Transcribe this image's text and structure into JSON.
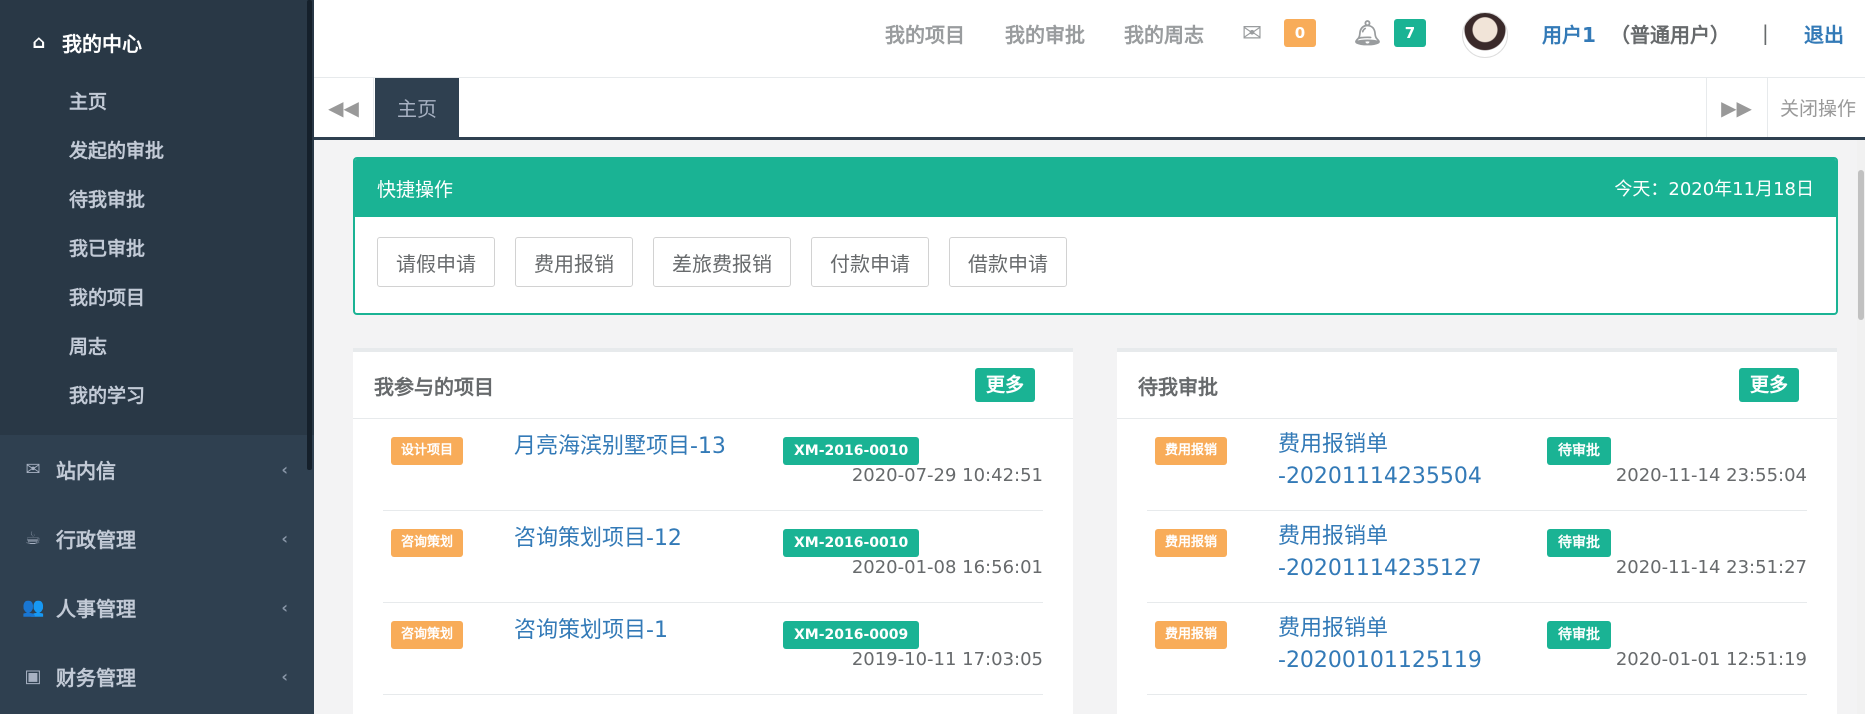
{
  "sidebar": {
    "active_section": {
      "icon": "home-icon",
      "label": "我的中心"
    },
    "sub_items": [
      "主页",
      "发起的审批",
      "待我审批",
      "我已审批",
      "我的项目",
      "周志",
      "我的学习"
    ],
    "groups": [
      {
        "icon": "envelope-icon",
        "label": "站内信"
      },
      {
        "icon": "coffee-icon",
        "label": "行政管理"
      },
      {
        "icon": "users-icon",
        "label": "人事管理"
      },
      {
        "icon": "money-icon",
        "label": "财务管理"
      }
    ]
  },
  "topbar": {
    "links": [
      "我的项目",
      "我的审批",
      "我的周志"
    ],
    "mail_count": "0",
    "notify_count": "7",
    "user_name": "用户1",
    "user_role": "（普通用户）",
    "separator": "|",
    "logout": "退出"
  },
  "tabs": {
    "active_tab": "主页",
    "close_ops": "关闭操作"
  },
  "quick": {
    "title": "快捷操作",
    "date": "今天：2020年11月18日",
    "buttons": [
      "请假申请",
      "费用报销",
      "差旅费报销",
      "付款申请",
      "借款申请"
    ]
  },
  "projects": {
    "title": "我参与的项目",
    "more": "更多",
    "rows": [
      {
        "tag": "设计项目",
        "title": "月亮海滨别墅项目-13",
        "code": "XM-2016-0010",
        "time": "2020-07-29 10:42:51"
      },
      {
        "tag": "咨询策划",
        "title": "咨询策划项目-12",
        "code": "XM-2016-0010",
        "time": "2020-01-08 16:56:01"
      },
      {
        "tag": "咨询策划",
        "title": "咨询策划项目-1",
        "code": "XM-2016-0009",
        "time": "2019-10-11 17:03:05"
      }
    ]
  },
  "approvals": {
    "title": "待我审批",
    "more": "更多",
    "rows": [
      {
        "tag": "费用报销",
        "title_1": "费用报销单",
        "title_2": "-20201114235504",
        "status": "待审批",
        "time": "2020-11-14 23:55:04"
      },
      {
        "tag": "费用报销",
        "title_1": "费用报销单",
        "title_2": "-20201114235127",
        "status": "待审批",
        "time": "2020-11-14 23:51:27"
      },
      {
        "tag": "费用报销",
        "title_1": "费用报销单",
        "title_2": "-20200101125119",
        "status": "待审批",
        "time": "2020-01-01 12:51:19"
      }
    ]
  },
  "colors": {
    "sidebar": "#2f4050",
    "accent": "#1ab394",
    "warning": "#f8ac59",
    "link": "#337ab7"
  }
}
